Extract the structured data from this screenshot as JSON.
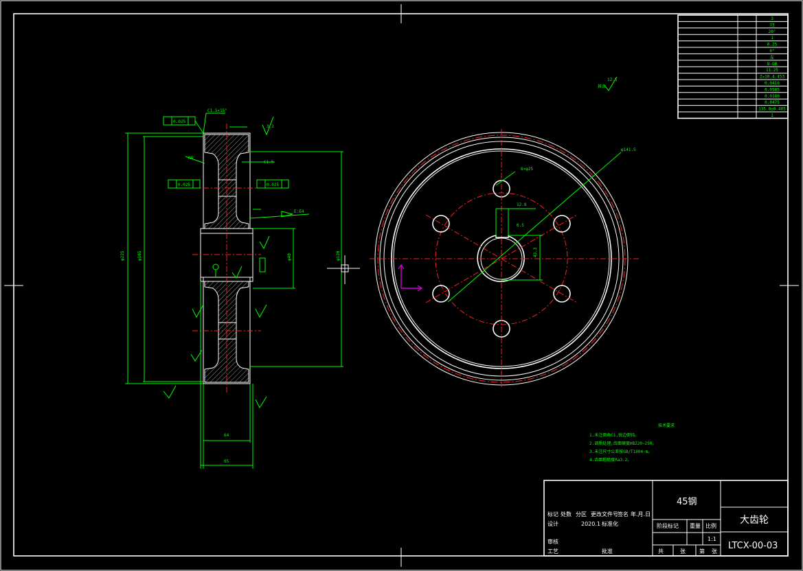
{
  "params": [
    [
      "",
      "",
      "3"
    ],
    [
      "",
      "",
      "73"
    ],
    [
      "",
      "",
      "20°"
    ],
    [
      "",
      "",
      "1"
    ],
    [
      "",
      "",
      "0.25"
    ],
    [
      "",
      "",
      "0°"
    ],
    [
      "",
      "",
      "左"
    ],
    [
      "",
      "",
      "8-GB"
    ],
    [
      "",
      "",
      "11.25"
    ],
    [
      "",
      "",
      "Z=10.4.453"
    ],
    [
      "",
      "",
      "0.0416"
    ],
    [
      "",
      "",
      "0.0585"
    ],
    [
      "",
      "",
      "0.0180"
    ],
    [
      "",
      "",
      "0.0475"
    ],
    [
      "",
      "",
      "135.8±0.405"
    ],
    [
      "",
      "",
      "1"
    ]
  ],
  "drawing": {
    "material": "45钢",
    "part_name": "大齿轮",
    "drawing_no": "LTCX-00-03",
    "tb_row1": [
      "标记",
      "处数",
      "分区",
      "更改文件号",
      "签名",
      "年.月.日"
    ],
    "tb_designer": "设计",
    "tb_date": "2020.1",
    "tb_std": "标准化",
    "tb_check": "审核",
    "tb_craft": "工艺",
    "tb_approve": "批准",
    "tb_stage": [
      "阶段标记",
      "重量",
      "比例"
    ],
    "tb_scale": "1:1",
    "tb_sheets": [
      "共",
      "张",
      "第",
      "张"
    ]
  },
  "notes": {
    "title": "技术要求",
    "lines": [
      "1.未注倒角C1,锐边倒钝。",
      "2.调质处理,齿面硬度HB220~250。",
      "3.未注尺寸公差按GB/T1804-m。",
      "4.齿面粗糙度Ra3.2。"
    ]
  },
  "labels": {
    "rest": "其余",
    "rough_rest": "12.5",
    "d_top": "φ225",
    "d_root": "φ165",
    "d_hole": "φ120",
    "d_bore": "φ40",
    "tol1": "0.025",
    "tol2": "0.025",
    "tol3": "0.025",
    "chamfer": "C1.5×15°",
    "width1": "64",
    "width2": "65",
    "key": "12.8",
    "kw": "6.5",
    "bolt": "6×φ25",
    "pcd": "φ141.5",
    "hub": "43.3",
    "r": "R8",
    "rough": "3.2",
    "section": "E:E4",
    "dim_c": "C1.5"
  }
}
